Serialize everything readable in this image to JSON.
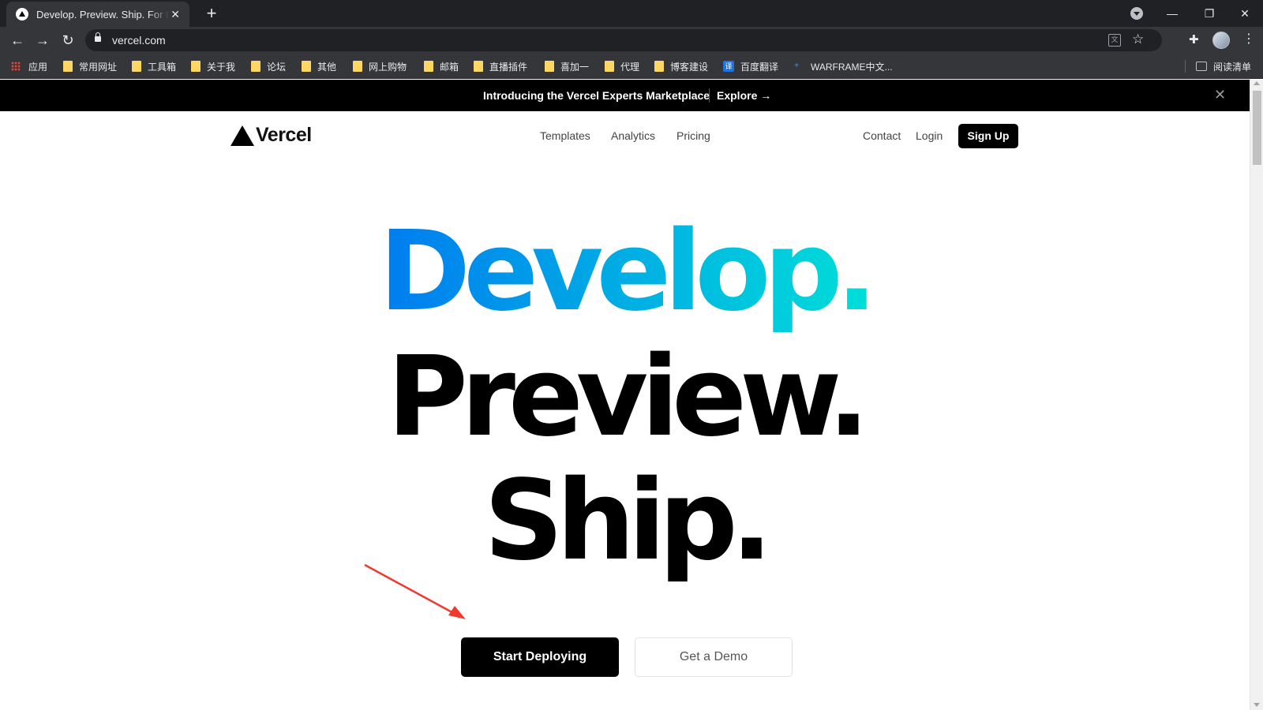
{
  "browser": {
    "tab_title": "Develop. Preview. Ship. For the best frontend teams – Vercel",
    "tab_close": "✕",
    "new_tab": "+",
    "url": "vercel.com",
    "window_controls": {
      "minimize": "—",
      "maximize": "❐",
      "close": "✕"
    },
    "bookmarks": [
      {
        "label": "应用",
        "icon": "apps-icon"
      },
      {
        "label": "常用网址",
        "icon": "folder-icon"
      },
      {
        "label": "工具箱",
        "icon": "folder-icon"
      },
      {
        "label": "关于我",
        "icon": "folder-icon"
      },
      {
        "label": "论坛",
        "icon": "folder-icon"
      },
      {
        "label": "其他",
        "icon": "folder-icon"
      },
      {
        "label": "网上购物",
        "icon": "folder-icon"
      },
      {
        "label": "邮箱",
        "icon": "folder-icon"
      },
      {
        "label": "直播插件",
        "icon": "folder-icon"
      },
      {
        "label": "喜加一",
        "icon": "folder-icon"
      },
      {
        "label": "代理",
        "icon": "folder-icon"
      },
      {
        "label": "博客建设",
        "icon": "folder-icon"
      },
      {
        "label": "百度翻译",
        "icon": "translate-icon"
      },
      {
        "label": "WARFRAME中文...",
        "icon": "warframe-icon"
      }
    ],
    "reading_list": "阅读清单"
  },
  "banner": {
    "text": "Introducing the Vercel Experts Marketplace",
    "link": "Explore →",
    "close": "✕"
  },
  "site": {
    "logo_text": "Vercel",
    "nav": {
      "templates": "Templates",
      "analytics": "Analytics",
      "pricing": "Pricing",
      "contact": "Contact",
      "login": "Login",
      "signup": "Sign Up"
    },
    "hero": {
      "line1": "Develop.",
      "line2": "Preview.",
      "line3": "Ship."
    },
    "cta": {
      "primary": "Start Deploying",
      "secondary": "Get a Demo"
    }
  },
  "colors": {
    "gradient_start": "#007cf0",
    "gradient_end": "#00dfd8",
    "annotation_arrow": "#f03a2e"
  }
}
